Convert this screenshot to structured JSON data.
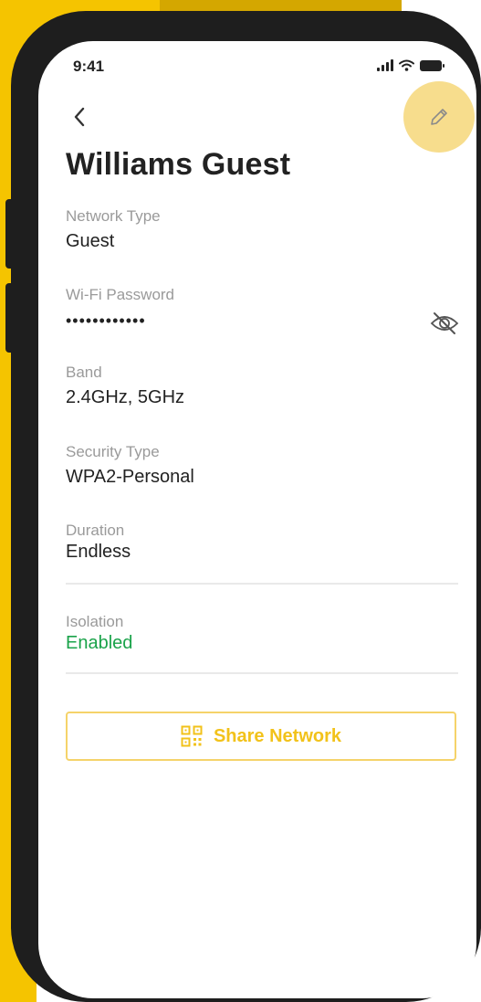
{
  "status_bar": {
    "time": "9:41"
  },
  "header": {
    "title": "Williams Guest"
  },
  "fields": {
    "network_type": {
      "label": "Network Type",
      "value": "Guest"
    },
    "password": {
      "label": "Wi-Fi Password",
      "value": "••••••••••••"
    },
    "band": {
      "label": "Band",
      "value": "2.4GHz, 5GHz"
    },
    "security": {
      "label": "Security Type",
      "value": "WPA2-Personal"
    },
    "duration": {
      "label": "Duration",
      "value": "Endless"
    },
    "isolation": {
      "label": "Isolation",
      "value": "Enabled"
    }
  },
  "actions": {
    "share_label": "Share Network"
  },
  "icons": {
    "back": "chevron-left-icon",
    "edit": "pencil-icon",
    "password_visibility": "eye-off-icon",
    "share": "qr-code-icon"
  },
  "colors": {
    "accent_yellow": "#f5c400",
    "edit_circle": "#f7dd8d",
    "share_text": "#f2c21a",
    "enabled_green": "#1aa34a",
    "phone_frame": "#1e1e1e"
  }
}
